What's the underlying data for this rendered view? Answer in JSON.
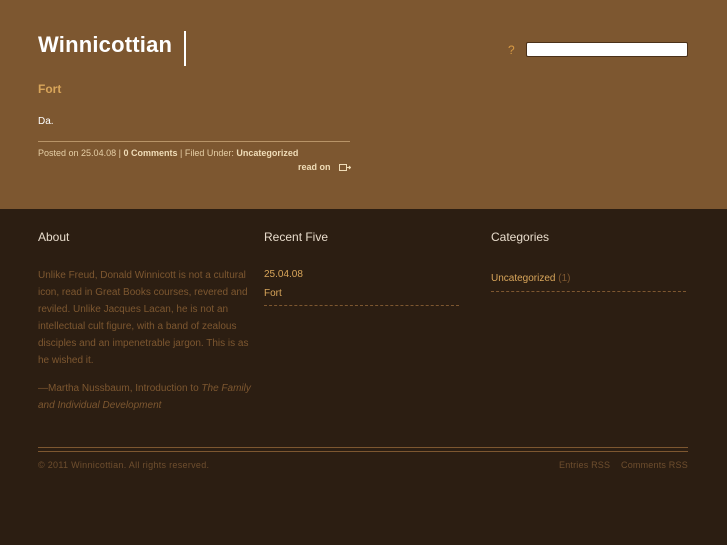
{
  "site": {
    "title": "Winnicottian"
  },
  "search": {
    "prompt": "?",
    "value": "",
    "placeholder": ""
  },
  "post": {
    "title": "Fort",
    "body": "Da.",
    "posted_on_label": "Posted on",
    "date": "25.04.08",
    "sep1": "|",
    "comments_link": "0 Comments",
    "sep2": "|",
    "filed_under_label": "Filed Under:",
    "category_link": "Uncategorized",
    "read_on": "read on"
  },
  "about": {
    "heading": "About",
    "text": "Unlike Freud, Donald Winnicott is not a cultural icon, read in Great Books courses, revered and reviled. Unlike Jacques Lacan, he is not an intellectual cult figure, with a band of zealous disciples and an impenetrable jargon. This is as he wished it.",
    "citation_prefix": "—Martha Nussbaum, Introduction to",
    "citation_title": "The Family and Individual Development"
  },
  "recent": {
    "heading": "Recent Five",
    "items": [
      {
        "date": "25.04.08",
        "title": "Fort"
      }
    ]
  },
  "categories": {
    "heading": "Categories",
    "items": [
      {
        "name": "Uncategorized",
        "count": "(1)"
      }
    ]
  },
  "footer": {
    "copyright": "© 2011 Winnicottian. All rights reserved.",
    "entries_rss": "Entries RSS",
    "comments_rss": "Comments RSS"
  },
  "colors": {
    "header_bg": "#7d5730",
    "body_bg": "#2c1e12",
    "accent": "#d8a55a"
  }
}
